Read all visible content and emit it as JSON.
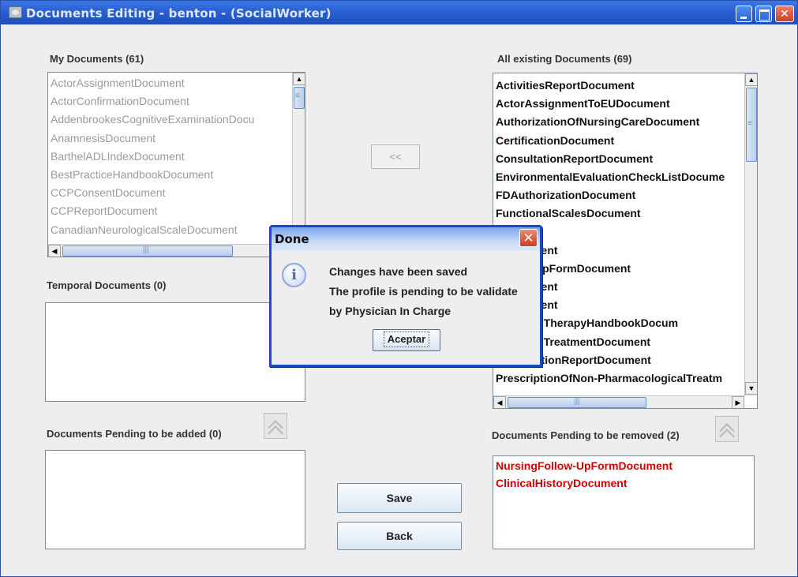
{
  "window": {
    "title": "Documents Editing - benton - (SocialWorker)",
    "controls": {
      "minimize": "",
      "maximize": "",
      "close": "✕"
    }
  },
  "my_documents": {
    "label": "My Documents (61)",
    "items": [
      "ActorAssignmentDocument",
      "ActorConfirmationDocument",
      "AddenbrookesCognitiveExaminationDocu",
      "AnamnesisDocument",
      "BarthelADLIndexDocument",
      "BestPracticeHandbookDocument",
      "CCPConsentDocument",
      "CCPReportDocument",
      "CanadianNeurologicalScaleDocument"
    ]
  },
  "move_left_button": {
    "label": "<<"
  },
  "all_documents": {
    "label": "All existing Documents (69)",
    "items": [
      "ActivitiesReportDocument",
      "ActorAssignmentToEUDocument",
      "AuthorizationOfNursingCareDocument",
      "CertificationDocument",
      "ConsultationReportDocument",
      "EnvironmentalEvaluationCheckListDocume",
      "FDAuthorizationDocument",
      "FunctionalScalesDocument",
      "ment",
      "rtDocument",
      "Follow-UpFormDocument",
      "rtDocument",
      "rtDocument",
      "cologicalTherapyHandbookDocum",
      "cologicalTreatmentDocument",
      "ExaminationReportDocument",
      "PrescriptionOfNon-PharmacologicalTreatm"
    ]
  },
  "temporal_documents": {
    "label": "Temporal Documents (0)",
    "items": []
  },
  "pending_added": {
    "label": "Documents Pending to be added (0)",
    "items": []
  },
  "pending_removed": {
    "label": "Documents Pending to be removed (2)",
    "items": [
      "NursingFollow-UpFormDocument",
      "ClinicalHistoryDocument"
    ]
  },
  "actions": {
    "save": "Save",
    "back": "Back"
  },
  "dialog": {
    "title": "Done",
    "close": "✕",
    "icon": "i",
    "lines": [
      "Changes have been saved",
      "The profile is pending to be validate",
      "by Physician In Charge"
    ],
    "accept": "Aceptar"
  },
  "colors": {
    "titlebar": "#2a5fd2",
    "pending_removed_text": "#d00000",
    "disabled_text": "#9a9a9a"
  }
}
